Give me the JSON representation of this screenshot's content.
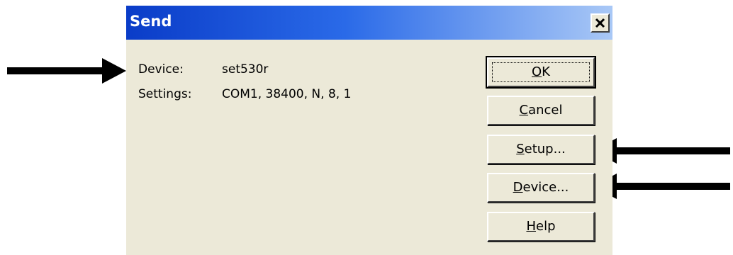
{
  "dialog": {
    "title": "Send",
    "device_label": "Device:",
    "device_value": "set530r",
    "settings_label": "Settings:",
    "settings_value": "COM1, 38400, N, 8, 1"
  },
  "buttons": {
    "ok": "OK",
    "cancel": "Cancel",
    "setup": "Setup...",
    "device": "Device...",
    "help": "Help"
  },
  "icons": {
    "close": "close-icon",
    "arrow": "arrow-icon"
  },
  "colors": {
    "titlebar_start": "#0a3cc8",
    "titlebar_end": "#a9c8f6",
    "dialog_bg": "#ece9d8"
  }
}
